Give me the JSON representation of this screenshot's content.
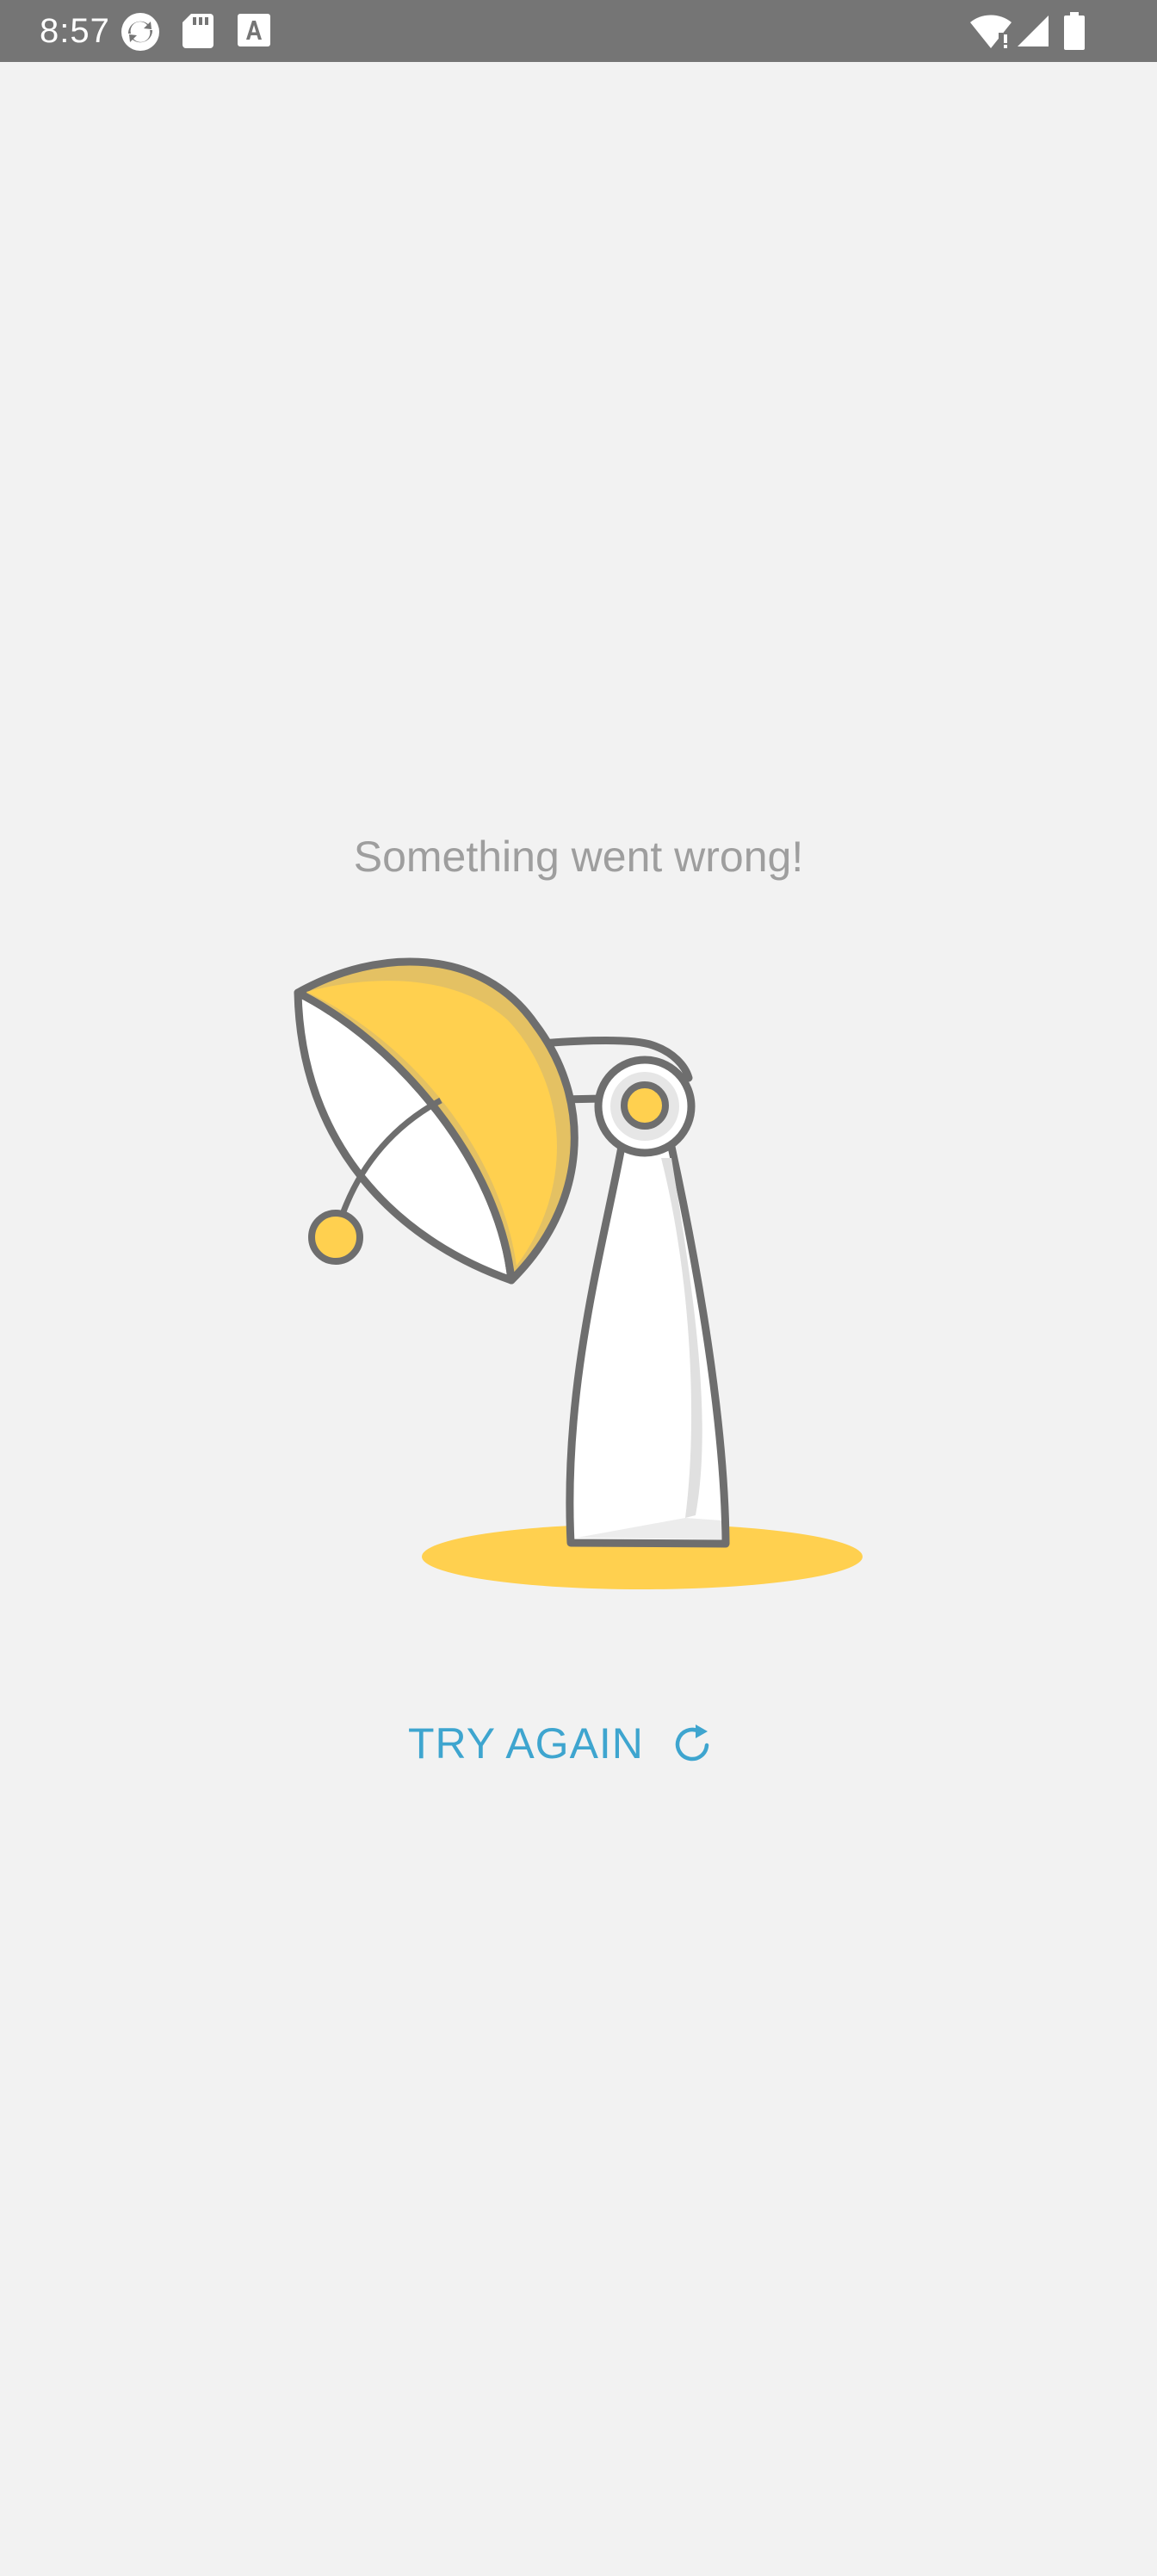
{
  "status_bar": {
    "time": "8:57",
    "left_icons": [
      "sync-icon",
      "sd-card-icon",
      "font-download-icon"
    ],
    "right_icons": [
      "wifi-icon",
      "cell-signal-icon",
      "battery-icon"
    ]
  },
  "error": {
    "message": "Something went wrong!"
  },
  "illustration": {
    "icon": "desk-lamp-icon",
    "colors": {
      "accent": "#ffd04f",
      "outline": "#6e6e6e",
      "shade": "#e0e0e0"
    }
  },
  "action": {
    "label": "TRY AGAIN",
    "icon": "refresh-icon",
    "color": "#3ea5cf"
  }
}
